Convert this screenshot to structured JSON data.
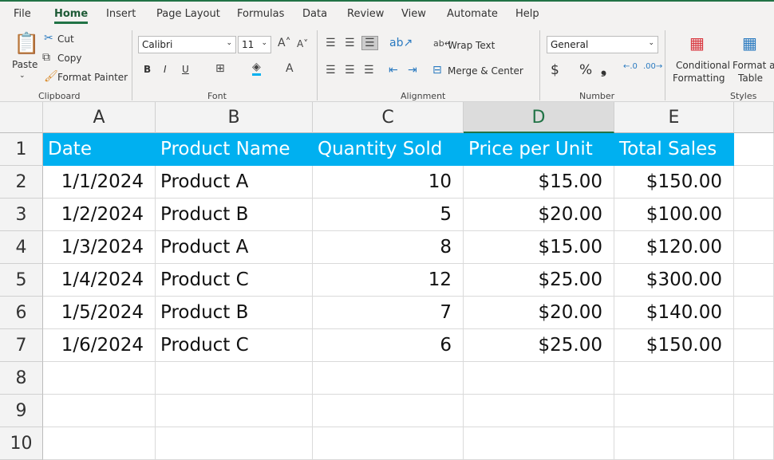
{
  "tabs": [
    "File",
    "Home",
    "Insert",
    "Page Layout",
    "Formulas",
    "Data",
    "Review",
    "View",
    "Automate",
    "Help"
  ],
  "active_tab": "Home",
  "clipboard": {
    "paste": "Paste",
    "cut": "Cut",
    "copy": "Copy",
    "format_painter": "Format Painter",
    "label": "Clipboard"
  },
  "font": {
    "name": "Calibri",
    "size": "11",
    "bold": "B",
    "italic": "I",
    "underline": "U",
    "label": "Font"
  },
  "alignment": {
    "wrap_text": "Wrap Text",
    "merge_center": "Merge & Center",
    "label": "Alignment"
  },
  "number": {
    "format": "General",
    "currency": "$",
    "percent": "%",
    "comma": "❟",
    "label": "Number"
  },
  "styles": {
    "conditional": "Conditional",
    "formatting": "Formatting",
    "format_as": "Format as",
    "table": "Table",
    "label": "Styles"
  },
  "columns": [
    "A",
    "B",
    "C",
    "D",
    "E"
  ],
  "selected_column": "D",
  "rows": [
    "1",
    "2",
    "3",
    "4",
    "5",
    "6",
    "7",
    "8",
    "9",
    "10"
  ],
  "header_fill": "#00B0F0",
  "table": {
    "headers": [
      "Date",
      "Product Name",
      "Quantity Sold",
      "Price per Unit",
      "Total Sales"
    ],
    "data": [
      [
        "1/1/2024",
        "Product A",
        "10",
        "$15.00",
        "$150.00"
      ],
      [
        "1/2/2024",
        "Product B",
        "5",
        "$20.00",
        "$100.00"
      ],
      [
        "1/3/2024",
        "Product A",
        "8",
        "$15.00",
        "$120.00"
      ],
      [
        "1/4/2024",
        "Product C",
        "12",
        "$25.00",
        "$300.00"
      ],
      [
        "1/5/2024",
        "Product B",
        "7",
        "$20.00",
        "$140.00"
      ],
      [
        "1/6/2024",
        "Product C",
        "6",
        "$25.00",
        "$150.00"
      ]
    ]
  }
}
